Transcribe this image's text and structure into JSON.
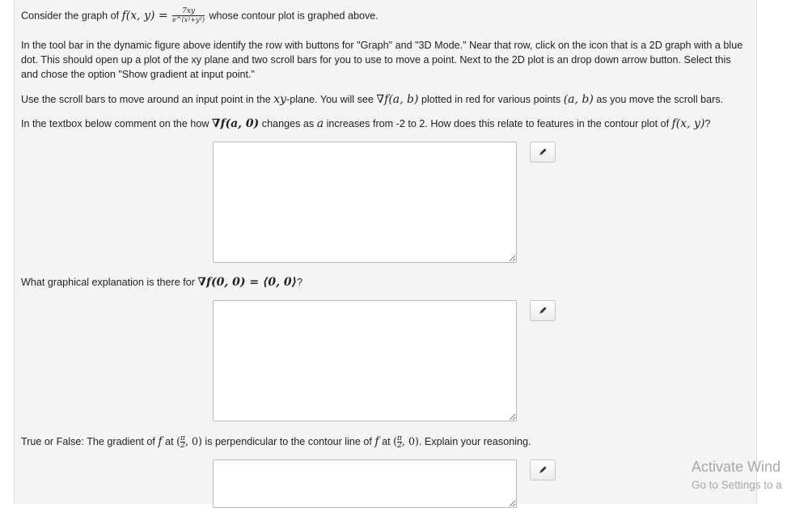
{
  "intro": {
    "before": "Consider the graph of ",
    "fn": "f(x, y) =",
    "frac_num": "7xy",
    "frac_den": "e^(x²+y²)",
    "after": "whose contour plot is graphed above."
  },
  "instructions": "In the tool bar in the dynamic figure above identify the row with buttons for \"Graph\" and \"3D Mode.\" Near that row, click on the icon that is a 2D graph with a blue dot. This should open up a plot of the xy plane and two scroll bars for you to use to move a point. Next to the 2D plot is an drop down arrow button. Select this and chose the option \"Show gradient at input point.\"",
  "scroll_note": {
    "p1": "Use the scroll bars to move around an input point in the ",
    "xy": "xy",
    "p2": "-plane. You will see ",
    "grad": "∇f(a, b)",
    "p3": " plotted in red for various points ",
    "pt": "(a, b)",
    "p4": " as you move the scroll bars."
  },
  "q1": {
    "p1": "In the textbox below comment on the how ",
    "grad": "∇f(a, 0)",
    "p2": " changes as ",
    "a": "a",
    "p3": " increases from -2 to 2. How does this relate to features in the contour plot of ",
    "fxy": "f(x, y)",
    "p4": "?"
  },
  "q2": {
    "p1": "What graphical explanation is there for ",
    "grad": "∇f(0, 0) = ⟨0, 0⟩",
    "p2": "?"
  },
  "q3": {
    "p1": "True or False: The gradient of ",
    "f1": "f",
    "p2": " at ",
    "pt1_open": "(",
    "pi": "π",
    "two": "2",
    "pt1_close": ", 0)",
    "p3": " is perpendicular to the contour line of ",
    "f2": "f",
    "p4": " at ",
    "pt2_open": "(",
    "pt2_close": ", 0)",
    "p5": ". Explain your reasoning."
  },
  "edit_icon": "pencil-icon",
  "watermark": {
    "line1": "Activate Wind",
    "line2": "Go to Settings to a"
  },
  "colors": {
    "panel_bg": "#f4f4f4",
    "textarea_border": "#b9b9b9",
    "watermark": "#a8a8a8"
  }
}
